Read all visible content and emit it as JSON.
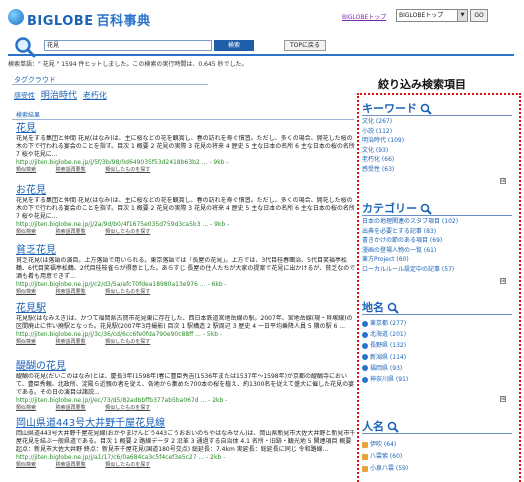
{
  "header": {
    "logo_brand": "BIGLOBE",
    "logo_sub": "百科事典",
    "toplink": "BIGLOBEトップ",
    "site_select_value": "BIGLOBEトップ",
    "go_label": "GO"
  },
  "search": {
    "query": "花見",
    "search_button": "検索",
    "top_button": "TOPに戻る",
    "summary": "検索単語：\" 花見 \" 1594 件ヒットしました。この検索の実行時間は、0.645 秒でした。"
  },
  "tag_cloud": {
    "title": "タグクラウド",
    "tags": [
      "感受性",
      "明治時代",
      "老朽化"
    ]
  },
  "results_title": "検索結果",
  "results": [
    {
      "title": "花見",
      "snippet": "花見をする集団と仲間 花見(はなみ)は、主に桜などの花を観賞し、春の訪れを寿ぐ慣習。ただし、多くの場合、開花した桜の木の下で行われる宴会のことを指す。目次 1 概要 2 花見の実際 3 花見の将来 4 歴史 5 主な日本の名所 6 主な日本の桜の名所 7 桜や花見に...",
      "url": "http://jiten.biglobe.ne.jp/j/5f/3b/98/0d649035f53d2418b63b2 ... - 9kb -",
      "links": [
        "類似検索",
        "検索語再要覧",
        "類似したものを探す"
      ]
    },
    {
      "title": "お花見",
      "snippet": "花見をする集団と仲間 花見(はなみ)は、主に桜などの花を観賞し、春の訪れを寿ぐ慣習。ただし、多くの場合、開花した桜の木の下で行われる宴会のことを指す。目次 1 概要 2 花見の実際 3 花見の将来 4 歴史 5 主な日本の名所 6 主な日本の桜の名所 7 桜や花見に...",
      "url": "http://jiten.biglobe.ne.jp/j/2a/9d/b0/4f1675e035d759d3ca5b3 ... - 9kb -",
      "links": [
        "類似検索",
        "検索語再要覧",
        "類似したものを探す"
      ]
    },
    {
      "title": "貧乏花見",
      "snippet": "貧乏花見(は落語の演目。上方落語で用いられる。東京落語では「長屋の花見」。上方では、3代目桂春團治、5代目笑福亭松鶴、6代目笑福亭松鶴、2代目桂枝雀らが得意とした。あらすじ 長屋の住人たちが大家の提案で花見に出かけるが、貧乏なので酒も肴も用意できず...",
      "url": "http://jiten.biglobe.ne.jp/j/c2/d3/5a/afc70fdea18980a13e976 ... - 6kb -",
      "links": [
        "類似検索",
        "検索語再要覧",
        "類似したものを探す"
      ]
    },
    {
      "title": "花見駅",
      "snippet": "花見駅(はなみえき)は、かつて福岡県古賀市花見東に存在した、西日本鉄道宮地岳線の駅。2007年、宮地岳線(現・貝塚線)の区間廃止に伴い廃駅となった。花見駅(2007年3月撮影) 目次 1 駅構造 2 駅周辺 3 歴史 4 一日平均乗降人員 5 隣の駅 6 ...",
      "url": "http://jiten.biglobe.ne.jp/j/3c/36/cd/6cc6fe0fda790e90c88ff ... - 5kb -",
      "links": [
        "類似検索",
        "検索語再要覧",
        "類似したものを探す"
      ]
    },
    {
      "title": "醍醐の花見",
      "snippet": "醍醐の花見(だいごのはなみ)とは、慶長3年(1598年)春に豊臣秀吉(1536年または1537年～1598年)が京都の醍醐寺において、豊臣秀頼、北政所、淀殿ら近親の者を従え、各地から集めた700本の桜を植え、約1300名を従えて盛大に催した花見の宴である。その日の演目は諸説...",
      "url": "http://jiten.biglobe.ne.jp/j/ec/73/d5/82adbbffb377ab5ba067d ... - 2kb -",
      "links": [
        "類似検索",
        "検索語再要覧",
        "類似したものを探す"
      ]
    },
    {
      "title": "岡山県道443号大井野千屋花見線",
      "snippet": "岡山県道443号大井野千屋花見線(おかやまけんどう443ごうおおいのちやはなみせん)は、岡山県新見市大佐大井野と新見市千屋花見を結ぶ一般県道である。目次 1 概要 2 路線データ 2 沿革 3 通過する自治体 4.1 名所・旧跡・観光地 5 関連項目 概要 起点：新見市大佐大井野 終点：新見市千屋花見(国道180号交点) 総延長：7.4km 実延長：総延長に同じ 令和路線...",
      "url": "http://jiten.biglobe.ne.jp/j/a1/17/c6/0a684ca3c5f4cef3e5c27 ... - 2kb -",
      "links": [
        "類似検索",
        "検索語再要覧",
        "類似したものを探す"
      ]
    }
  ],
  "refine": {
    "title": "絞り込み検索項目",
    "keyword": {
      "title": "キーワード",
      "items": [
        "文化 (267)",
        "小説 (112)",
        "明治時代 (109)",
        "文化 (93)",
        "老朽化 (66)",
        "感受性 (63)"
      ]
    },
    "category": {
      "title": "カテゴリー",
      "items": [
        "日本の地理関連のスタブ項目 (102)",
        "出典を必要とする記事 (83)",
        "書きかけの節のある項目 (69)",
        "漫画の登場人物の一覧 (61)",
        "東方Project (60)",
        "ローカルルール設定中の記事 (57)"
      ]
    },
    "place": {
      "title": "地名",
      "items": [
        "東京都 (277)",
        "北海道 (201)",
        "長野県 (132)",
        "新潟県 (114)",
        "福岡県 (93)",
        "神奈川県 (91)"
      ]
    },
    "person": {
      "title": "人名",
      "items": [
        "伊吹 (64)",
        "八雲紫 (60)",
        "小泉八雲 (59)"
      ]
    },
    "more_label": "⊞"
  },
  "colors": {
    "brand_blue": "#1b63b8",
    "refine_border": "#e01010",
    "url_green": "#2a8a2a"
  }
}
